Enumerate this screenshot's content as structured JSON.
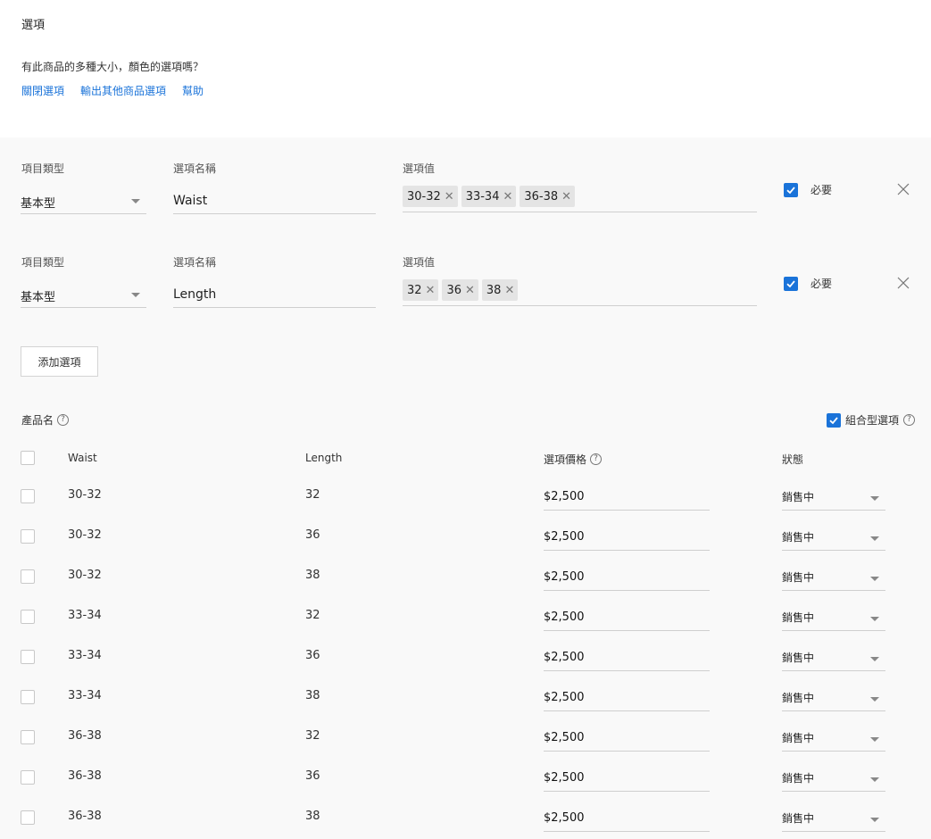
{
  "header": {
    "title": "選項",
    "question": "有此商品的多種大小，顏色的選項嗎？",
    "links": [
      "關閉選項",
      "輸出其他商品選項",
      "幫助"
    ]
  },
  "options": [
    {
      "type_label": "項目類型",
      "type_value": "基本型",
      "name_label": "選項名稱",
      "name_value": "Waist",
      "values_label": "選項值",
      "values": [
        "30-32",
        "33-34",
        "36-38"
      ],
      "required_label": "必要"
    },
    {
      "type_label": "項目類型",
      "type_value": "基本型",
      "name_label": "選項名稱",
      "name_value": "Length",
      "values_label": "選項值",
      "values": [
        "32",
        "36",
        "38"
      ],
      "required_label": "必要"
    }
  ],
  "add_button": "添加選項",
  "products": {
    "title": "產品名",
    "combo_label": "組合型選項",
    "columns": [
      "Waist",
      "Length",
      "選項價格",
      "狀態"
    ],
    "rows": [
      {
        "waist": "30-32",
        "length": "32",
        "price": "$2,500",
        "status": "銷售中"
      },
      {
        "waist": "30-32",
        "length": "36",
        "price": "$2,500",
        "status": "銷售中"
      },
      {
        "waist": "30-32",
        "length": "38",
        "price": "$2,500",
        "status": "銷售中"
      },
      {
        "waist": "33-34",
        "length": "32",
        "price": "$2,500",
        "status": "銷售中"
      },
      {
        "waist": "33-34",
        "length": "36",
        "price": "$2,500",
        "status": "銷售中"
      },
      {
        "waist": "33-34",
        "length": "38",
        "price": "$2,500",
        "status": "銷售中"
      },
      {
        "waist": "36-38",
        "length": "32",
        "price": "$2,500",
        "status": "銷售中"
      },
      {
        "waist": "36-38",
        "length": "36",
        "price": "$2,500",
        "status": "銷售中"
      },
      {
        "waist": "36-38",
        "length": "38",
        "price": "$2,500",
        "status": "銷售中"
      }
    ]
  },
  "colors": {
    "accent": "#1a73d9",
    "panel_bg": "#f9f9f9",
    "chip_bg": "#e4e4e4"
  },
  "icons": {
    "check": "check-icon",
    "remove_chip": "close-icon",
    "remove_option": "close-icon",
    "help": "question-circle-icon",
    "dropdown": "chevron-down-icon"
  }
}
